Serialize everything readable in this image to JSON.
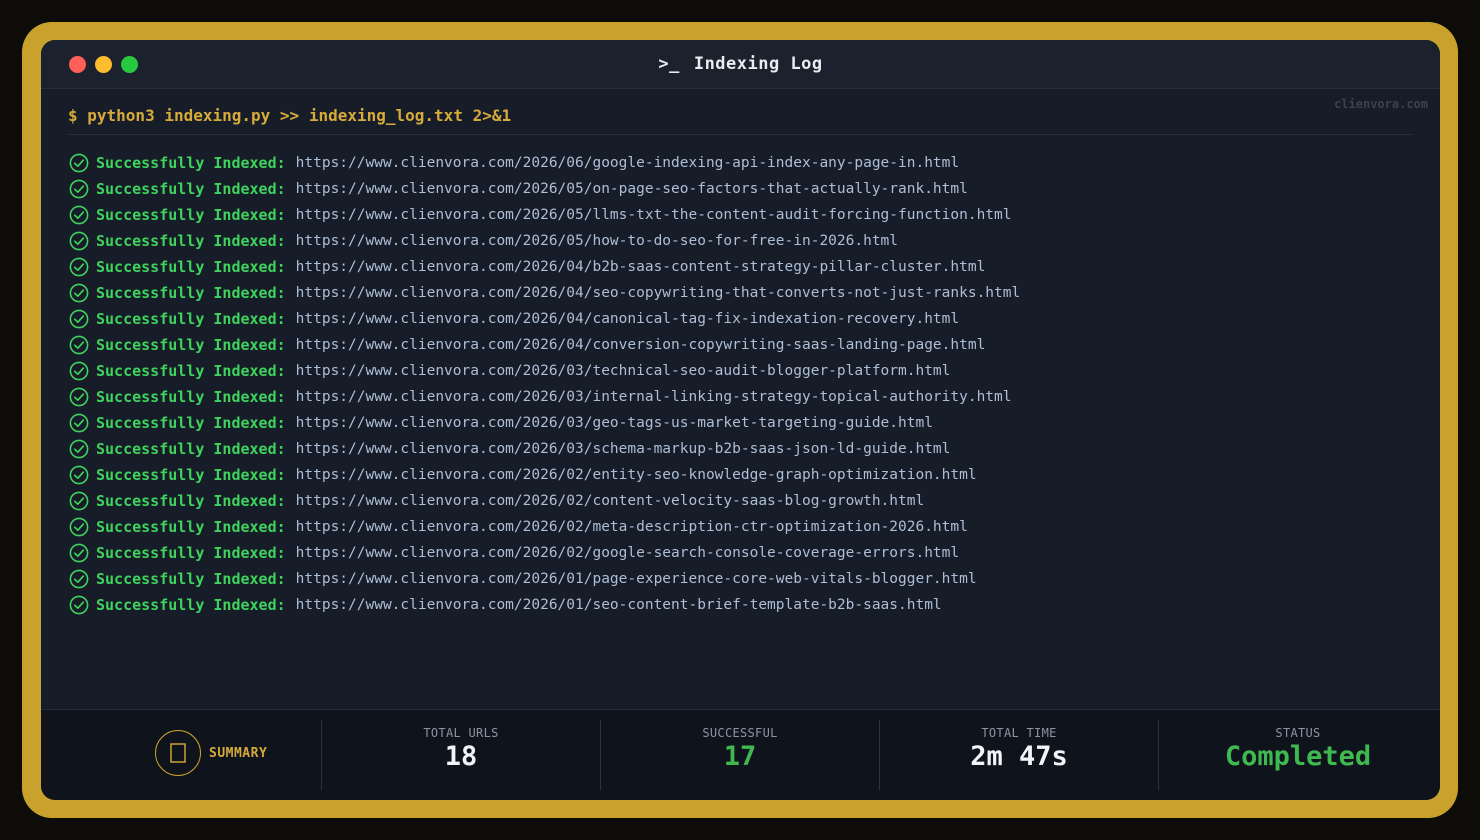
{
  "window": {
    "title": "Indexing Log",
    "title_icon": "terminal-prompt-icon",
    "watermark": "clienvora.com"
  },
  "terminal": {
    "command": "$ python3 indexing.py >> indexing_log.txt 2>&1",
    "status_label": "Successfully Indexed:",
    "lines": [
      "https://www.clienvora.com/2026/06/google-indexing-api-index-any-page-in.html",
      "https://www.clienvora.com/2026/05/on-page-seo-factors-that-actually-rank.html",
      "https://www.clienvora.com/2026/05/llms-txt-the-content-audit-forcing-function.html",
      "https://www.clienvora.com/2026/05/how-to-do-seo-for-free-in-2026.html",
      "https://www.clienvora.com/2026/04/b2b-saas-content-strategy-pillar-cluster.html",
      "https://www.clienvora.com/2026/04/seo-copywriting-that-converts-not-just-ranks.html",
      "https://www.clienvora.com/2026/04/canonical-tag-fix-indexation-recovery.html",
      "https://www.clienvora.com/2026/04/conversion-copywriting-saas-landing-page.html",
      "https://www.clienvora.com/2026/03/technical-seo-audit-blogger-platform.html",
      "https://www.clienvora.com/2026/03/internal-linking-strategy-topical-authority.html",
      "https://www.clienvora.com/2026/03/geo-tags-us-market-targeting-guide.html",
      "https://www.clienvora.com/2026/03/schema-markup-b2b-saas-json-ld-guide.html",
      "https://www.clienvora.com/2026/02/entity-seo-knowledge-graph-optimization.html",
      "https://www.clienvora.com/2026/02/content-velocity-saas-blog-growth.html",
      "https://www.clienvora.com/2026/02/meta-description-ctr-optimization-2026.html",
      "https://www.clienvora.com/2026/02/google-search-console-coverage-errors.html",
      "https://www.clienvora.com/2026/01/page-experience-core-web-vitals-blogger.html",
      "https://www.clienvora.com/2026/01/seo-content-brief-template-b2b-saas.html"
    ]
  },
  "summary": {
    "label": "SUMMARY",
    "icon": "summary-icon",
    "total_urls_label": "TOTAL URLS",
    "total_urls_value": "18",
    "successful_label": "SUCCESSFUL",
    "successful_value": "17",
    "total_time_label": "TOTAL TIME",
    "total_time_value": "2m 47s",
    "status_label": "STATUS",
    "status_value": "Completed"
  },
  "colors": {
    "frame": "#c9a22e",
    "success": "#3fd25d",
    "accent": "#d7ab3a"
  }
}
